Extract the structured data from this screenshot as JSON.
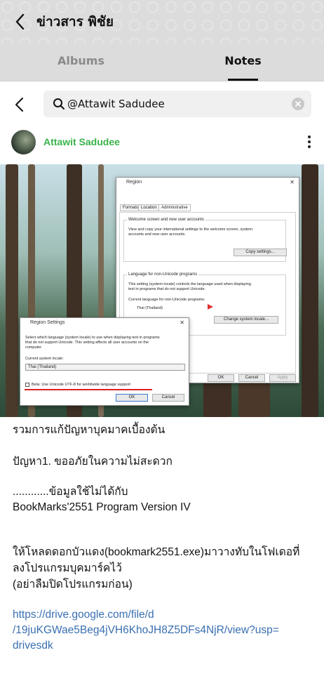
{
  "header": {
    "title": "ข่าวสาร พิชัย",
    "back_icon": "arrow-left-icon"
  },
  "tabs": [
    {
      "label": "Albums",
      "active": false
    },
    {
      "label": "Notes",
      "active": true
    }
  ],
  "search": {
    "value": "@Attawit Sadudee",
    "icon": "search-icon",
    "clear_icon": "clear-icon"
  },
  "post": {
    "author": "Attawit Sadudee",
    "author_color": "#39b34a",
    "image": {
      "region_window": {
        "title": "Region",
        "tabs": [
          "Formats",
          "Location",
          "Administrative"
        ],
        "welcome_group_title": "Welcome screen and new user accounts",
        "welcome_text": [
          "View and copy your international settings to the welcome screen, system",
          "accounts and new user accounts."
        ],
        "copy_button": "Copy settings...",
        "unicode_group_title": "Language for non-Unicode programs",
        "unicode_text": [
          "This setting (system locale) controls the language used when displaying",
          "text in programs that do not support Unicode."
        ],
        "current_label": "Current language for non-Unicode programs:",
        "current_value": "Thai (Thailand)",
        "change_button": "Change system locale...",
        "ok": "OK",
        "cancel": "Cancel",
        "apply": "Apply"
      },
      "settings_dialog": {
        "title": "Region Settings",
        "text": [
          "Select which language (system locale) to use when displaying text in programs",
          "that do not support Unicode. This setting affects all user accounts on the",
          "computer."
        ],
        "locale_label": "Current system locale:",
        "locale_value": "Thai (Thailand)",
        "beta_label": "Beta: Use Unicode UTF-8 for worldwide language support",
        "ok": "OK",
        "cancel": "Cancel"
      }
    },
    "lines": [
      "รวมการแก้ปัญหาบุคมาคเบื้องต้น",
      "ปัญหา1. ขออภัยในความไม่สะดวก",
      "............ข้อมูลใช้ไม่ได้กับ",
      "BookMarks'2551 Program Version IV",
      "ให้โหลดดอกบัวแดง(bookmark2551.exe)มาวางทับในโฟเดอที่",
      "ลงโปรแกรมบุคมาร์คไว้",
      "(อย่าลืมปิดโปรแกรมก่อน)"
    ],
    "link_lines": [
      "https://drive.google.com/file/d",
      "/19juKGWae5Beg4jVH6KhoJH8Z5DFs4NjR/view?usp=",
      "drivesdk"
    ]
  }
}
